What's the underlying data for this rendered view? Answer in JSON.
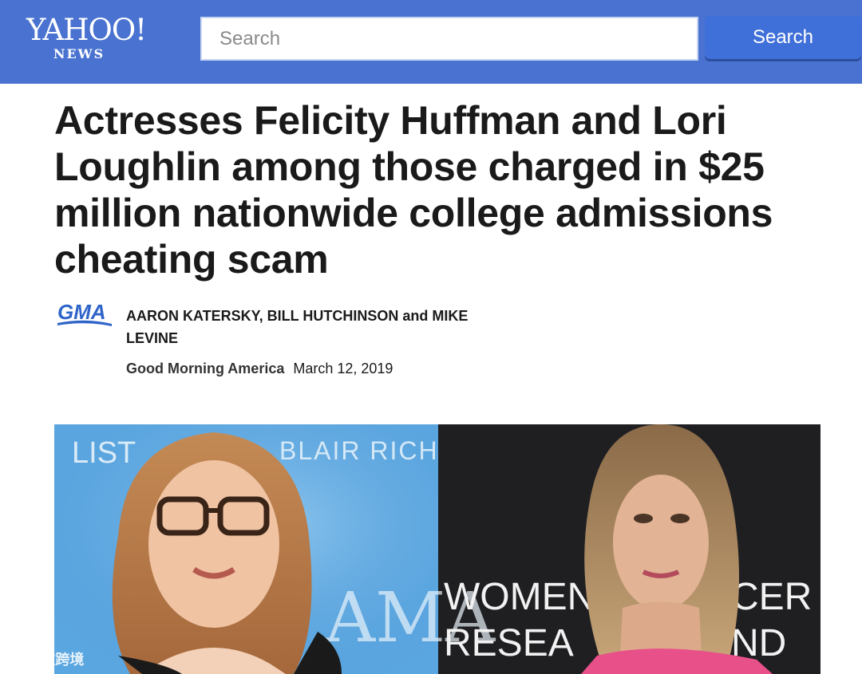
{
  "header": {
    "logo_main": "YAHOO!",
    "logo_sub": "NEWS",
    "search_placeholder": "Search",
    "search_button_label": "Search"
  },
  "article": {
    "headline": "Actresses Felicity Huffman and Lori Loughlin among those charged in $25 million nationwide college admissions cheating scam",
    "publisher_logo_text": "GMA",
    "authors": "AARON KATERSKY, BILL HUTCHINSON and MIKE LEVINE",
    "source": "Good Morning America",
    "date": "March 12, 2019"
  },
  "photo": {
    "left_backdrop_texts": [
      "LIST",
      "BLAIR RICH",
      "AMA"
    ],
    "right_backdrop_texts": [
      "WOMEN",
      "CER",
      "RESEA",
      "ND"
    ]
  },
  "watermark": {
    "text": "大数跨境"
  },
  "colors": {
    "header_bg": "#4a73d1",
    "search_button_bg": "#3f6fd8",
    "gma_blue": "#2f64c9"
  }
}
